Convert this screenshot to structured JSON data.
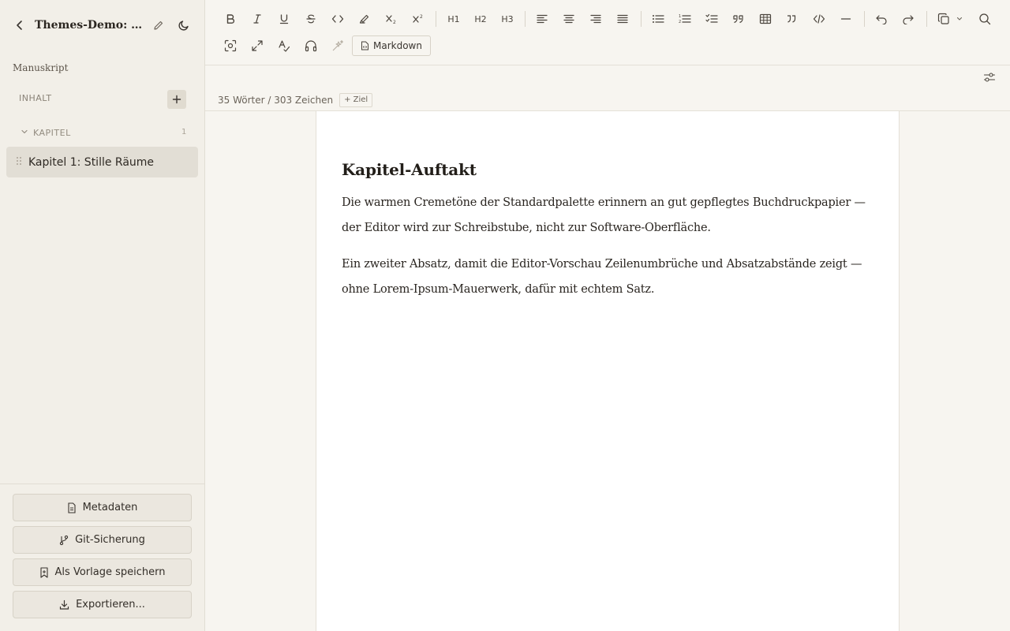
{
  "sidebar": {
    "project_title": "Themes-Demo: Warme Creme",
    "section_title": "Manuskript",
    "inhalt_label": "INHALT",
    "kapitel_label": "KAPITEL",
    "kapitel_count": "1",
    "chapters": [
      {
        "label": "Kapitel 1: Stille Räume"
      }
    ],
    "buttons": {
      "metadata": "Metadaten",
      "git": "Git-Sicherung",
      "template": "Als Vorlage speichern",
      "export": "Exportieren..."
    }
  },
  "toolbar": {
    "markdown_label": "Markdown",
    "h1": "H1",
    "h2": "H2",
    "h3": "H3"
  },
  "status": {
    "word_count": "35 Wörter / 303 Zeichen",
    "goal_label": "+ Ziel"
  },
  "document": {
    "heading": "Kapitel-Auftakt",
    "paragraphs": [
      "Die warmen Cremetöne der Standardpalette erinnern an gut gepflegtes Buchdruckpapier — der Editor wird zur Schreibstube, nicht zur Software-Oberfläche.",
      "Ein zweiter Absatz, damit die Editor-Vorschau Zeilenumbrüche und Absatzabstände zeigt — ohne Lorem-Ipsum-Mauerwerk, dafür mit echtem Satz."
    ]
  },
  "colors": {
    "background": "#f7f5f0",
    "sidebar": "#f2efe8",
    "page": "#ffffff",
    "selected_item": "#e2ded5"
  }
}
